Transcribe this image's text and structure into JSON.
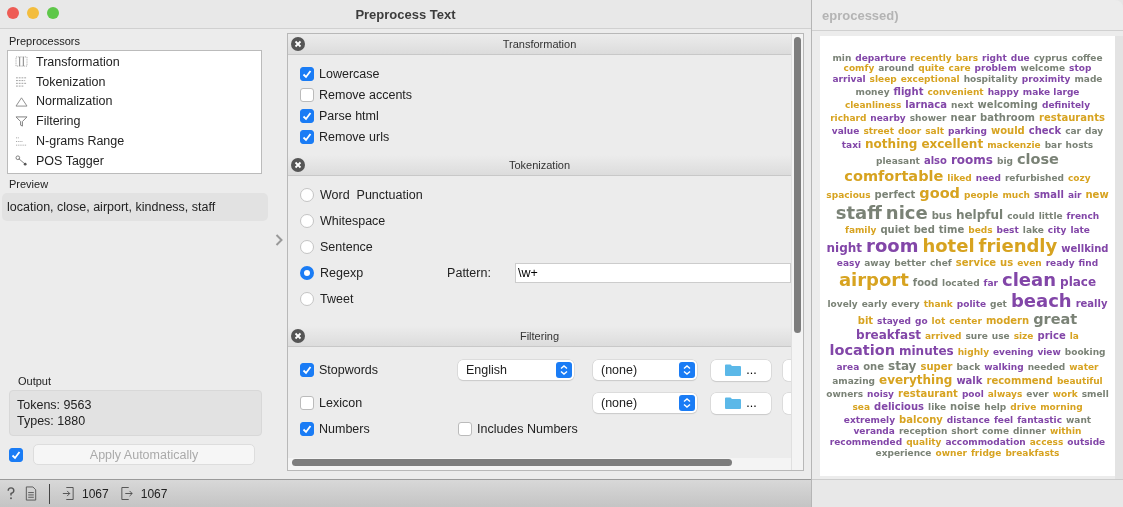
{
  "window": {
    "title": "Preprocess Text"
  },
  "preprocessors": {
    "label": "Preprocessors",
    "items": [
      {
        "label": "Transformation",
        "kind": "transformation"
      },
      {
        "label": "Tokenization",
        "kind": "tokenization"
      },
      {
        "label": "Normalization",
        "kind": "normalization"
      },
      {
        "label": "Filtering",
        "kind": "filtering"
      },
      {
        "label": "N-grams Range",
        "kind": "ngrams"
      },
      {
        "label": "POS Tagger",
        "kind": "pos"
      }
    ]
  },
  "preview": {
    "label": "Preview",
    "text": "location, close, airport, kindness, staff"
  },
  "output": {
    "label": "Output",
    "lines": [
      "Tokens: 9563",
      "Types: 1880"
    ]
  },
  "apply": {
    "checked": true,
    "label": "Apply Automatically",
    "disabled": true
  },
  "status_bar": {
    "input_count": "1067",
    "output_count": "1067"
  },
  "sections": [
    {
      "title": "Transformation",
      "kind": "checks",
      "options": [
        {
          "label": "Lowercase",
          "checked": true
        },
        {
          "label": "Remove accents",
          "checked": false
        },
        {
          "label": "Parse html",
          "checked": true
        },
        {
          "label": "Remove urls",
          "checked": true
        }
      ]
    },
    {
      "title": "Tokenization",
      "kind": "radios",
      "options": [
        {
          "label": "Word  Punctuation",
          "selected": false
        },
        {
          "label": "Whitespace",
          "selected": false
        },
        {
          "label": "Sentence",
          "selected": false
        },
        {
          "label": "Regexp",
          "selected": true,
          "pattern_label": "Pattern:",
          "pattern": "\\w+"
        },
        {
          "label": "Tweet",
          "selected": false
        }
      ]
    },
    {
      "title": "Filtering",
      "kind": "filters",
      "rows": [
        {
          "label": "Stopwords",
          "checked": true,
          "language": "English",
          "list": "(none)",
          "browse": "..."
        },
        {
          "label": "Lexicon",
          "checked": false,
          "list": "(none)",
          "browse": "..."
        },
        {
          "label": "Numbers",
          "checked": true,
          "extra": {
            "label": "Includes Numbers",
            "checked": false
          }
        }
      ]
    }
  ],
  "cloud_window": {
    "title": "eprocessed)",
    "words": [
      {
        "text": "min",
        "color": "#7a8276",
        "kind": "xs"
      },
      {
        "text": "departure",
        "color": "#8246a8",
        "kind": "xs"
      },
      {
        "text": "recently",
        "color": "#d7a320",
        "kind": "xs"
      },
      {
        "text": "bars",
        "color": "#d7a320",
        "kind": "xs"
      },
      {
        "text": "right",
        "color": "#8246a8",
        "kind": "xs"
      },
      {
        "text": "due",
        "color": "#8246a8",
        "kind": "xs"
      },
      {
        "text": "cyprus",
        "color": "#7a8276",
        "kind": "xs"
      },
      {
        "text": "coffee",
        "color": "#7a8276",
        "kind": "xs"
      },
      {
        "text": "comfy",
        "color": "#d7a320",
        "kind": "xs"
      },
      {
        "text": "around",
        "color": "#7a8276",
        "kind": "xs"
      },
      {
        "text": "quite",
        "color": "#d7a320",
        "kind": "xs"
      },
      {
        "text": "care",
        "color": "#d7a320",
        "kind": "xs"
      },
      {
        "text": "problem",
        "color": "#8246a8",
        "kind": "xs"
      },
      {
        "text": "welcome",
        "color": "#7a8276",
        "kind": "xs"
      },
      {
        "text": "stop",
        "color": "#8246a8",
        "kind": "xs"
      },
      {
        "text": "arrival",
        "color": "#8246a8",
        "kind": "xs"
      },
      {
        "text": "sleep",
        "color": "#d7a320",
        "kind": "xs"
      },
      {
        "text": "exceptional",
        "color": "#d7a320",
        "kind": "xs"
      },
      {
        "text": "hospitality",
        "color": "#7a8276",
        "kind": "xs"
      },
      {
        "text": "proximity",
        "color": "#8246a8",
        "kind": "xs"
      },
      {
        "text": "made",
        "color": "#7a8276",
        "kind": "xs"
      },
      {
        "text": "money",
        "color": "#7a8276",
        "kind": "xs"
      },
      {
        "text": "flight",
        "color": "#8246a8",
        "kind": "s"
      },
      {
        "text": "convenient",
        "color": "#d7a320",
        "kind": "xs"
      },
      {
        "text": "happy",
        "color": "#8246a8",
        "kind": "xs"
      },
      {
        "text": "make large",
        "color": "#8246a8",
        "kind": "xs"
      },
      {
        "text": "cleanliness",
        "color": "#d7a320",
        "kind": "xs"
      },
      {
        "text": "larnaca",
        "color": "#8246a8",
        "kind": "s"
      },
      {
        "text": "next",
        "color": "#7a8276",
        "kind": "xs"
      },
      {
        "text": "welcoming",
        "color": "#7a8276",
        "kind": "s"
      },
      {
        "text": "definitely",
        "color": "#8246a8",
        "kind": "xs"
      },
      {
        "text": "richard",
        "color": "#d7a320",
        "kind": "xs"
      },
      {
        "text": "nearby",
        "color": "#8246a8",
        "kind": "xs"
      },
      {
        "text": "shower",
        "color": "#7a8276",
        "kind": "xs"
      },
      {
        "text": "near",
        "color": "#7a8276",
        "kind": "s"
      },
      {
        "text": "bathroom",
        "color": "#7a8276",
        "kind": "s"
      },
      {
        "text": "restaurants",
        "color": "#d7a320",
        "kind": "s"
      },
      {
        "text": "value",
        "color": "#8246a8",
        "kind": "xs"
      },
      {
        "text": "street",
        "color": "#d7a320",
        "kind": "xs"
      },
      {
        "text": "door",
        "color": "#d7a320",
        "kind": "xs"
      },
      {
        "text": "salt",
        "color": "#d7a320",
        "kind": "xs"
      },
      {
        "text": "parking",
        "color": "#8246a8",
        "kind": "xs"
      },
      {
        "text": "would",
        "color": "#d7a320",
        "kind": "s"
      },
      {
        "text": "check",
        "color": "#8246a8",
        "kind": "s"
      },
      {
        "text": "car",
        "color": "#7a8276",
        "kind": "xs"
      },
      {
        "text": "day",
        "color": "#7a8276",
        "kind": "xs"
      },
      {
        "text": "taxi",
        "color": "#8246a8",
        "kind": "xs"
      },
      {
        "text": "nothing",
        "color": "#d7a320",
        "kind": "m"
      },
      {
        "text": "excellent",
        "color": "#d7a320",
        "kind": "m"
      },
      {
        "text": "mackenzie",
        "color": "#d7a320",
        "kind": "xs"
      },
      {
        "text": "bar",
        "color": "#7a8276",
        "kind": "xs"
      },
      {
        "text": "hosts",
        "color": "#7a8276",
        "kind": "xs"
      },
      {
        "text": "pleasant",
        "color": "#7a8276",
        "kind": "xs"
      },
      {
        "text": "also",
        "color": "#8246a8",
        "kind": "s"
      },
      {
        "text": "rooms",
        "color": "#8246a8",
        "kind": "m"
      },
      {
        "text": "big",
        "color": "#7a8276",
        "kind": "xs"
      },
      {
        "text": "close",
        "color": "#7a8276",
        "kind": "l"
      },
      {
        "text": "comfortable",
        "color": "#d7a320",
        "kind": "l"
      },
      {
        "text": "liked",
        "color": "#d7a320",
        "kind": "xs"
      },
      {
        "text": "need",
        "color": "#8246a8",
        "kind": "xs"
      },
      {
        "text": "refurbished",
        "color": "#7a8276",
        "kind": "xs"
      },
      {
        "text": "cozy",
        "color": "#d7a320",
        "kind": "xs"
      },
      {
        "text": "spacious",
        "color": "#d7a320",
        "kind": "xs"
      },
      {
        "text": "perfect",
        "color": "#7a8276",
        "kind": "s"
      },
      {
        "text": "good",
        "color": "#d7a320",
        "kind": "l"
      },
      {
        "text": "people",
        "color": "#d7a320",
        "kind": "xs"
      },
      {
        "text": "much",
        "color": "#d7a320",
        "kind": "xs"
      },
      {
        "text": "small",
        "color": "#8246a8",
        "kind": "s"
      },
      {
        "text": "air",
        "color": "#8246a8",
        "kind": "xs"
      },
      {
        "text": "new",
        "color": "#d7a320",
        "kind": "s"
      },
      {
        "text": "staff",
        "color": "#7a8276",
        "kind": "xl"
      },
      {
        "text": "nice",
        "color": "#7a8276",
        "kind": "xl"
      },
      {
        "text": "bus",
        "color": "#7a8276",
        "kind": "s"
      },
      {
        "text": "helpful",
        "color": "#7a8276",
        "kind": "m"
      },
      {
        "text": "could",
        "color": "#7a8276",
        "kind": "xs"
      },
      {
        "text": "little",
        "color": "#7a8276",
        "kind": "xs"
      },
      {
        "text": "french",
        "color": "#8246a8",
        "kind": "xs"
      },
      {
        "text": "family",
        "color": "#d7a320",
        "kind": "xs"
      },
      {
        "text": "quiet",
        "color": "#7a8276",
        "kind": "s"
      },
      {
        "text": "bed",
        "color": "#7a8276",
        "kind": "s"
      },
      {
        "text": "time",
        "color": "#7a8276",
        "kind": "s"
      },
      {
        "text": "beds",
        "color": "#d7a320",
        "kind": "xs"
      },
      {
        "text": "best",
        "color": "#8246a8",
        "kind": "xs"
      },
      {
        "text": "lake",
        "color": "#7a8276",
        "kind": "xs"
      },
      {
        "text": "city",
        "color": "#8246a8",
        "kind": "xs"
      },
      {
        "text": "late",
        "color": "#8246a8",
        "kind": "xs"
      },
      {
        "text": "night",
        "color": "#8246a8",
        "kind": "m"
      },
      {
        "text": "room",
        "color": "#8246a8",
        "kind": "xl"
      },
      {
        "text": "hotel",
        "color": "#d7a320",
        "kind": "xl"
      },
      {
        "text": "friendly",
        "color": "#d7a320",
        "kind": "xl"
      },
      {
        "text": "wellkind",
        "color": "#8246a8",
        "kind": "s"
      },
      {
        "text": "easy",
        "color": "#8246a8",
        "kind": "xs"
      },
      {
        "text": "away",
        "color": "#7a8276",
        "kind": "xs"
      },
      {
        "text": "better",
        "color": "#7a8276",
        "kind": "xs"
      },
      {
        "text": "chef",
        "color": "#7a8276",
        "kind": "xs"
      },
      {
        "text": "service",
        "color": "#d7a320",
        "kind": "s"
      },
      {
        "text": "us",
        "color": "#d7a320",
        "kind": "s"
      },
      {
        "text": "even",
        "color": "#d7a320",
        "kind": "xs"
      },
      {
        "text": "ready",
        "color": "#8246a8",
        "kind": "xs"
      },
      {
        "text": "find",
        "color": "#8246a8",
        "kind": "xs"
      },
      {
        "text": "airport",
        "color": "#d7a320",
        "kind": "xl"
      },
      {
        "text": "food",
        "color": "#7a8276",
        "kind": "s"
      },
      {
        "text": "located",
        "color": "#7a8276",
        "kind": "xs"
      },
      {
        "text": "far",
        "color": "#8246a8",
        "kind": "xs"
      },
      {
        "text": "clean",
        "color": "#8246a8",
        "kind": "xl"
      },
      {
        "text": "place",
        "color": "#8246a8",
        "kind": "m"
      },
      {
        "text": "lovely",
        "color": "#7a8276",
        "kind": "xs"
      },
      {
        "text": "early",
        "color": "#7a8276",
        "kind": "xs"
      },
      {
        "text": "every",
        "color": "#7a8276",
        "kind": "xs"
      },
      {
        "text": "thank",
        "color": "#d7a320",
        "kind": "xs"
      },
      {
        "text": "polite",
        "color": "#8246a8",
        "kind": "xs"
      },
      {
        "text": "get",
        "color": "#7a8276",
        "kind": "xs"
      },
      {
        "text": "beach",
        "color": "#8246a8",
        "kind": "xl"
      },
      {
        "text": "really",
        "color": "#8246a8",
        "kind": "s"
      },
      {
        "text": "bit",
        "color": "#d7a320",
        "kind": "s"
      },
      {
        "text": "stayed",
        "color": "#8246a8",
        "kind": "xs"
      },
      {
        "text": "go",
        "color": "#8246a8",
        "kind": "xs"
      },
      {
        "text": "lot",
        "color": "#d7a320",
        "kind": "xs"
      },
      {
        "text": "center",
        "color": "#d7a320",
        "kind": "xs"
      },
      {
        "text": "modern",
        "color": "#d7a320",
        "kind": "s"
      },
      {
        "text": "great",
        "color": "#7a8276",
        "kind": "l"
      },
      {
        "text": "breakfast",
        "color": "#8246a8",
        "kind": "m"
      },
      {
        "text": "arrived",
        "color": "#d7a320",
        "kind": "xs"
      },
      {
        "text": "sure",
        "color": "#7a8276",
        "kind": "xs"
      },
      {
        "text": "use",
        "color": "#7a8276",
        "kind": "xs"
      },
      {
        "text": "size",
        "color": "#d7a320",
        "kind": "xs"
      },
      {
        "text": "price",
        "color": "#8246a8",
        "kind": "s"
      },
      {
        "text": "la",
        "color": "#d7a320",
        "kind": "xs"
      },
      {
        "text": "location",
        "color": "#8246a8",
        "kind": "l"
      },
      {
        "text": "minutes",
        "color": "#8246a8",
        "kind": "m"
      },
      {
        "text": "highly",
        "color": "#d7a320",
        "kind": "xs"
      },
      {
        "text": "evening",
        "color": "#8246a8",
        "kind": "xs"
      },
      {
        "text": "view",
        "color": "#8246a8",
        "kind": "xs"
      },
      {
        "text": "booking",
        "color": "#7a8276",
        "kind": "xs"
      },
      {
        "text": "area",
        "color": "#8246a8",
        "kind": "xs"
      },
      {
        "text": "one",
        "color": "#7a8276",
        "kind": "s"
      },
      {
        "text": "stay",
        "color": "#7a8276",
        "kind": "m"
      },
      {
        "text": "super",
        "color": "#d7a320",
        "kind": "s"
      },
      {
        "text": "back",
        "color": "#7a8276",
        "kind": "xs"
      },
      {
        "text": "walking",
        "color": "#8246a8",
        "kind": "xs"
      },
      {
        "text": "needed",
        "color": "#7a8276",
        "kind": "xs"
      },
      {
        "text": "water",
        "color": "#d7a320",
        "kind": "xs"
      },
      {
        "text": "amazing",
        "color": "#7a8276",
        "kind": "xs"
      },
      {
        "text": "everything",
        "color": "#d7a320",
        "kind": "m"
      },
      {
        "text": "walk",
        "color": "#8246a8",
        "kind": "s"
      },
      {
        "text": "recommend",
        "color": "#d7a320",
        "kind": "s"
      },
      {
        "text": "beautiful",
        "color": "#d7a320",
        "kind": "xs"
      },
      {
        "text": "owners",
        "color": "#7a8276",
        "kind": "xs"
      },
      {
        "text": "noisy",
        "color": "#8246a8",
        "kind": "xs"
      },
      {
        "text": "restaurant",
        "color": "#d7a320",
        "kind": "s"
      },
      {
        "text": "pool",
        "color": "#8246a8",
        "kind": "xs"
      },
      {
        "text": "always",
        "color": "#d7a320",
        "kind": "xs"
      },
      {
        "text": "ever",
        "color": "#7a8276",
        "kind": "xs"
      },
      {
        "text": "work",
        "color": "#d7a320",
        "kind": "xs"
      },
      {
        "text": "smell",
        "color": "#7a8276",
        "kind": "xs"
      },
      {
        "text": "sea",
        "color": "#d7a320",
        "kind": "xs"
      },
      {
        "text": "delicious",
        "color": "#8246a8",
        "kind": "s"
      },
      {
        "text": "like",
        "color": "#7a8276",
        "kind": "xs"
      },
      {
        "text": "noise",
        "color": "#7a8276",
        "kind": "s"
      },
      {
        "text": "help",
        "color": "#7a8276",
        "kind": "xs"
      },
      {
        "text": "drive",
        "color": "#d7a320",
        "kind": "xs"
      },
      {
        "text": "morning",
        "color": "#d7a320",
        "kind": "xs"
      },
      {
        "text": "extremely",
        "color": "#8246a8",
        "kind": "xs"
      },
      {
        "text": "balcony",
        "color": "#d7a320",
        "kind": "s"
      },
      {
        "text": "distance",
        "color": "#8246a8",
        "kind": "xs"
      },
      {
        "text": "feel",
        "color": "#8246a8",
        "kind": "xs"
      },
      {
        "text": "fantastic",
        "color": "#8246a8",
        "kind": "xs"
      },
      {
        "text": "want",
        "color": "#7a8276",
        "kind": "xs"
      },
      {
        "text": "veranda",
        "color": "#8246a8",
        "kind": "xs"
      },
      {
        "text": "reception",
        "color": "#7a8276",
        "kind": "xs"
      },
      {
        "text": "short",
        "color": "#7a8276",
        "kind": "xs"
      },
      {
        "text": "come",
        "color": "#7a8276",
        "kind": "xs"
      },
      {
        "text": "dinner",
        "color": "#7a8276",
        "kind": "xs"
      },
      {
        "text": "within",
        "color": "#d7a320",
        "kind": "xs"
      },
      {
        "text": "recommended",
        "color": "#8246a8",
        "kind": "xs"
      },
      {
        "text": "quality",
        "color": "#d7a320",
        "kind": "xs"
      },
      {
        "text": "accommodation",
        "color": "#8246a8",
        "kind": "xs"
      },
      {
        "text": "access",
        "color": "#d7a320",
        "kind": "xs"
      },
      {
        "text": "outside",
        "color": "#8246a8",
        "kind": "xs"
      },
      {
        "text": "experience",
        "color": "#7a8276",
        "kind": "xs"
      },
      {
        "text": "owner",
        "color": "#d7a320",
        "kind": "xs"
      },
      {
        "text": "fridge",
        "color": "#d7a320",
        "kind": "xs"
      },
      {
        "text": "breakfasts",
        "color": "#d7a320",
        "kind": "xs"
      }
    ]
  }
}
